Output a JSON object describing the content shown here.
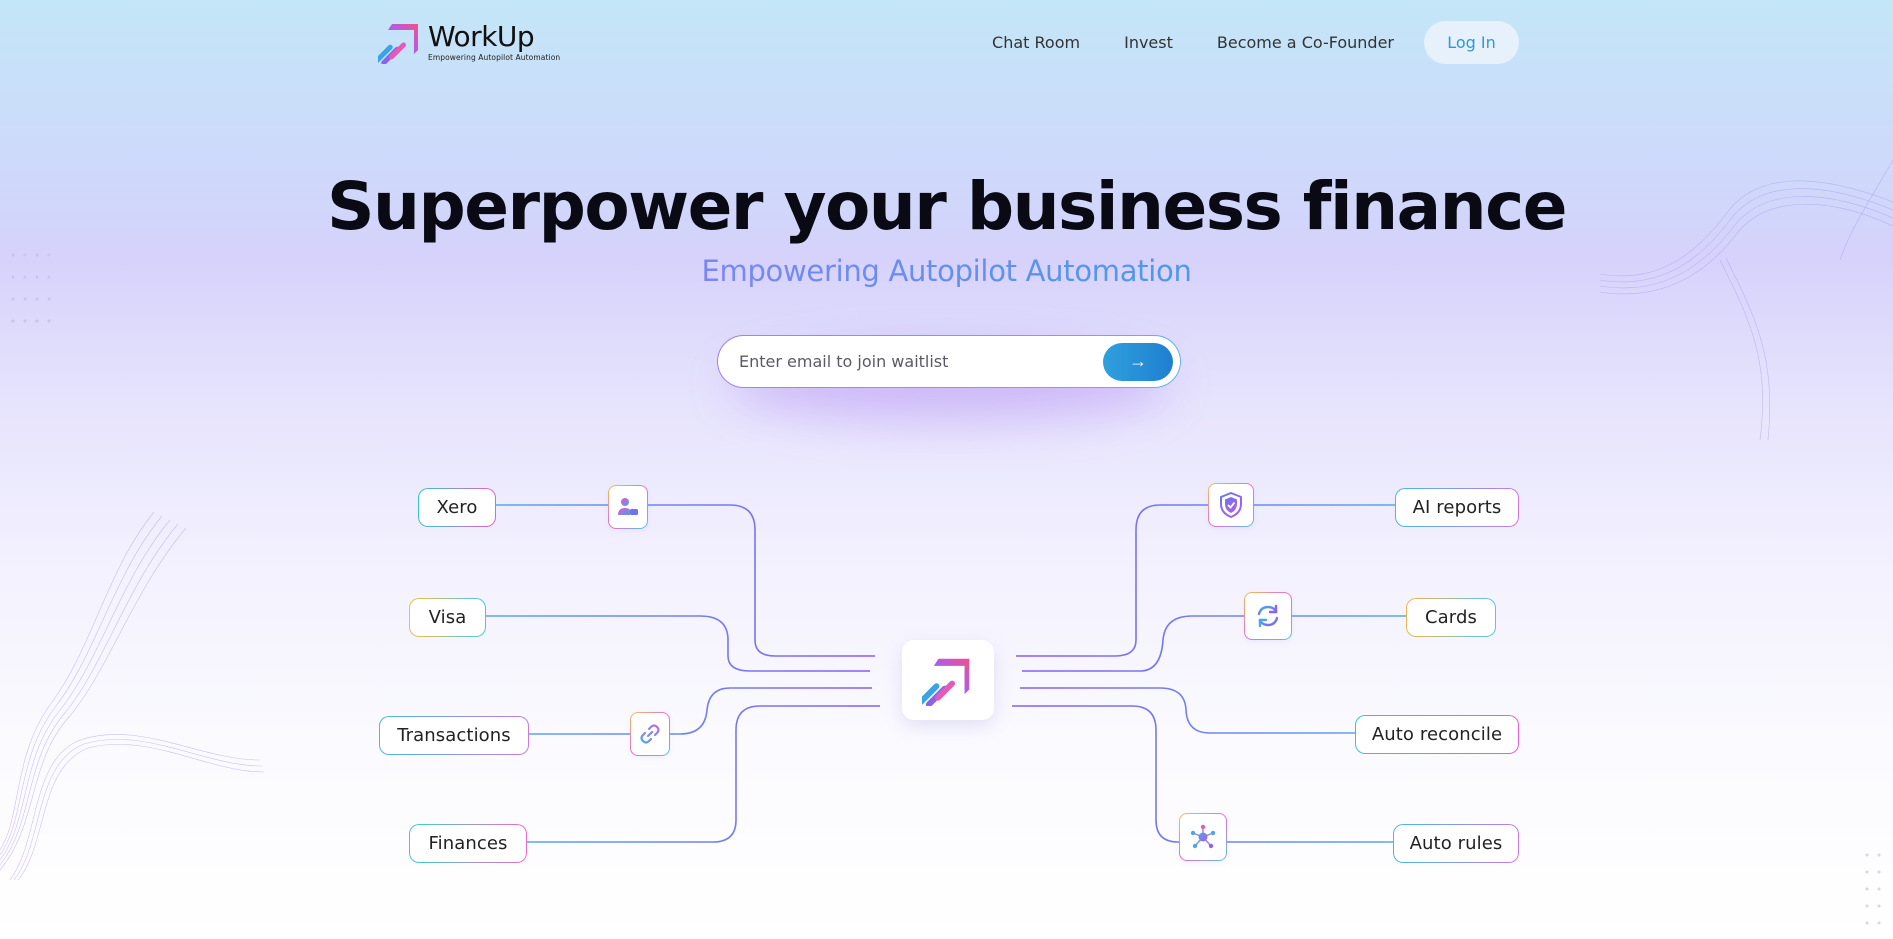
{
  "brand": {
    "name": "WorkUp",
    "tagline": "Empowering Autopilot Automation"
  },
  "nav": {
    "links": [
      "Chat Room",
      "Invest",
      "Become a Co-Founder"
    ],
    "login_label": "Log In"
  },
  "hero": {
    "title": "Superpower your business finance",
    "subtitle": "Empowering Autopilot Automation",
    "email_placeholder": "Enter email to join waitlist",
    "submit_icon": "arrow-right-icon",
    "submit_glyph": "→"
  },
  "diagram": {
    "left_nodes": [
      "Xero",
      "Visa",
      "Transactions",
      "Finances"
    ],
    "right_nodes": [
      "AI reports",
      "Cards",
      "Auto reconcile",
      "Auto rules"
    ],
    "icons": [
      "user-chat-icon",
      "link-icon",
      "shield-check-icon",
      "sync-icon",
      "network-icon"
    ],
    "line_colors": {
      "start": "#5aa6ee",
      "end": "#8a5cf0"
    }
  }
}
